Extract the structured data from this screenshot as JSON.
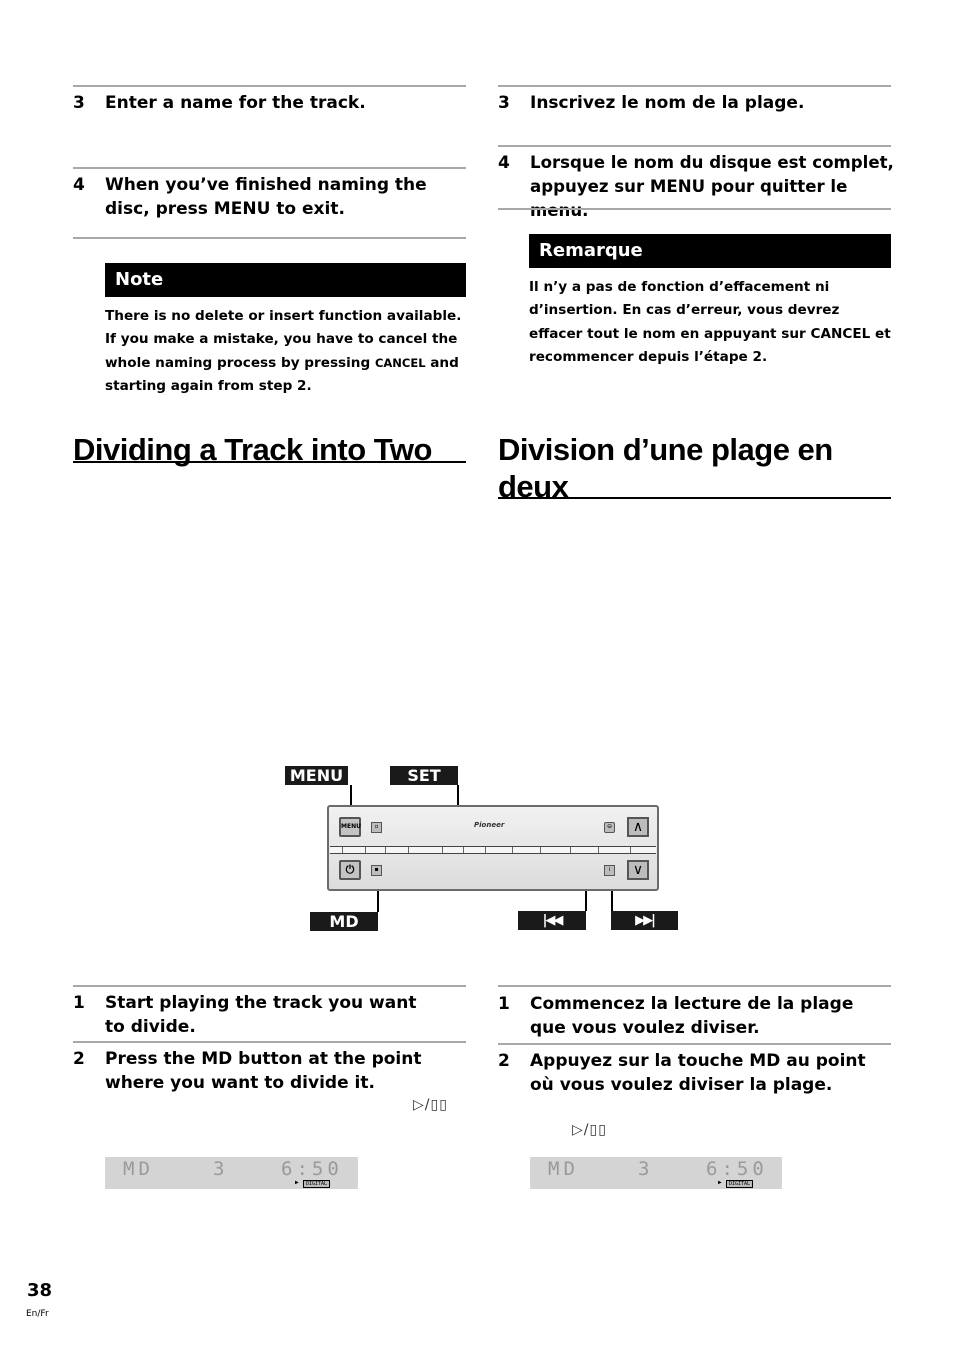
{
  "english": {
    "naming_steps": [
      {
        "num": "3",
        "text": "Enter a name for the track."
      },
      {
        "num": "4",
        "text": "When you’ve finished naming the disc, press MENU to exit."
      }
    ],
    "note": {
      "title": "Note",
      "body_before": "There is no delete or insert function available. If you make a mistake, you have to cancel the whole naming process by pressing ",
      "body_keyword": "CANCEL",
      "body_after": " and starting again from step 2."
    },
    "section_title": "Dividing a Track into Two",
    "divide_steps": [
      {
        "num": "1",
        "text": "Start playing the track you want to divide."
      },
      {
        "num": "2",
        "text": "Press the MD button at the point where you want to divide it."
      }
    ],
    "play_pause_symbol": "▷/▯▯"
  },
  "french": {
    "naming_steps": [
      {
        "num": "3",
        "text": "Inscrivez le nom de la plage."
      },
      {
        "num": "4",
        "text": "Lorsque le nom du disque est complet, appuyez sur MENU pour quitter le menu."
      }
    ],
    "note": {
      "title": "Remarque",
      "body": "Il n’y a pas de fonction d’effacement ni d’insertion. En cas d’erreur, vous devrez effacer tout le nom en appuyant sur CANCEL et recommencer depuis l’étape 2."
    },
    "section_title": "Division d’une plage en deux",
    "divide_steps": [
      {
        "num": "1",
        "text": "Commencez la lecture de la plage que vous voulez diviser."
      },
      {
        "num": "2",
        "text": "Appuyez sur la touche MD au point où vous voulez diviser la plage."
      }
    ],
    "play_pause_symbol": "▷/▯▯"
  },
  "diagram": {
    "callouts": {
      "menu": "MENU",
      "set": "SET",
      "md": "MD",
      "prev": "◀◀ (skip back)",
      "next": "▶▶ (skip forward)"
    },
    "callout_glyphs": {
      "prev": "|◀◀",
      "next": "▶▶|"
    },
    "panel": {
      "menu_button_label": "MENU",
      "brand": "Pioneer",
      "up_arrow": "∧",
      "down_arrow": "∨"
    }
  },
  "display": {
    "source": "MD",
    "track": "3",
    "time": "6:50",
    "indicator": "DIGITAL"
  },
  "footer": {
    "page_number": "38",
    "language": "En/Fr"
  }
}
